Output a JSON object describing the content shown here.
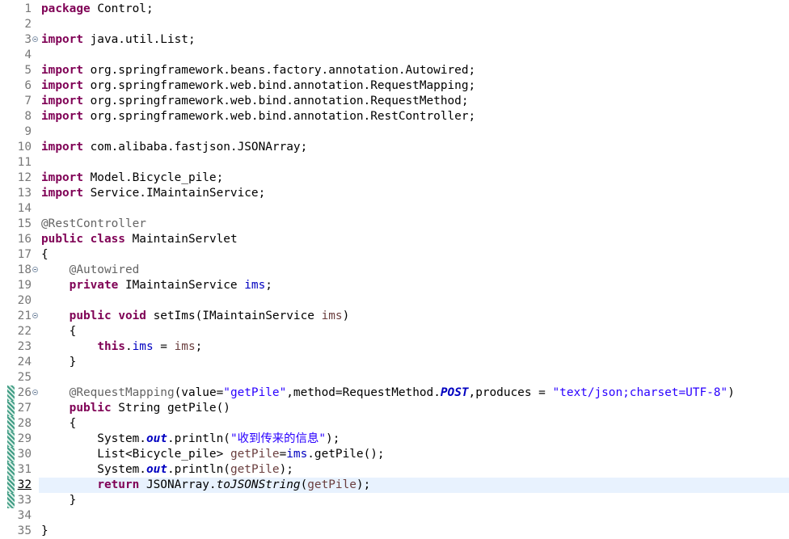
{
  "editor": {
    "lines": [
      {
        "num": "1",
        "code": "package Control;"
      },
      {
        "num": "2",
        "code": ""
      },
      {
        "num": "3",
        "code": "import java.util.List;"
      },
      {
        "num": "4",
        "code": ""
      },
      {
        "num": "5",
        "code": "import org.springframework.beans.factory.annotation.Autowired;"
      },
      {
        "num": "6",
        "code": "import org.springframework.web.bind.annotation.RequestMapping;"
      },
      {
        "num": "7",
        "code": "import org.springframework.web.bind.annotation.RequestMethod;"
      },
      {
        "num": "8",
        "code": "import org.springframework.web.bind.annotation.RestController;"
      },
      {
        "num": "9",
        "code": ""
      },
      {
        "num": "10",
        "code": "import com.alibaba.fastjson.JSONArray;"
      },
      {
        "num": "11",
        "code": ""
      },
      {
        "num": "12",
        "code": "import Model.Bicycle_pile;"
      },
      {
        "num": "13",
        "code": "import Service.IMaintainService;"
      },
      {
        "num": "14",
        "code": ""
      },
      {
        "num": "15",
        "code": "@RestController"
      },
      {
        "num": "16",
        "code": "public class MaintainServlet"
      },
      {
        "num": "17",
        "code": "{"
      },
      {
        "num": "18",
        "code": "    @Autowired"
      },
      {
        "num": "19",
        "code": "    private IMaintainService ims;"
      },
      {
        "num": "20",
        "code": ""
      },
      {
        "num": "21",
        "code": "    public void setIms(IMaintainService ims)"
      },
      {
        "num": "22",
        "code": "    {"
      },
      {
        "num": "23",
        "code": "        this.ims = ims;"
      },
      {
        "num": "24",
        "code": "    }"
      },
      {
        "num": "25",
        "code": ""
      },
      {
        "num": "26",
        "code": "    @RequestMapping(value=\"getPile\",method=RequestMethod.POST,produces = \"text/json;charset=UTF-8\")"
      },
      {
        "num": "27",
        "code": "    public String getPile()"
      },
      {
        "num": "28",
        "code": "    {"
      },
      {
        "num": "29",
        "code": "        System.out.println(\"收到传来的信息\");"
      },
      {
        "num": "30",
        "code": "        List<Bicycle_pile> getPile=ims.getPile();"
      },
      {
        "num": "31",
        "code": "        System.out.println(getPile);"
      },
      {
        "num": "32",
        "code": "        return JSONArray.toJSONString(getPile);"
      },
      {
        "num": "33",
        "code": "    }"
      },
      {
        "num": "34",
        "code": ""
      },
      {
        "num": "35",
        "code": "}"
      }
    ],
    "current_line": "32",
    "foldable_lines": [
      "3",
      "18",
      "21",
      "26"
    ],
    "changed_lines": [
      "26",
      "27",
      "28",
      "29",
      "30",
      "31",
      "32",
      "33"
    ],
    "colors": {
      "keyword": "#7f0055",
      "annotation": "#646464",
      "field": "#0000c0",
      "string": "#2a00ff",
      "local_variable": "#6a3e3e",
      "line_number": "#787878",
      "current_line_highlight": "#e8f2fe",
      "change_bar": "#3f9c84"
    }
  }
}
